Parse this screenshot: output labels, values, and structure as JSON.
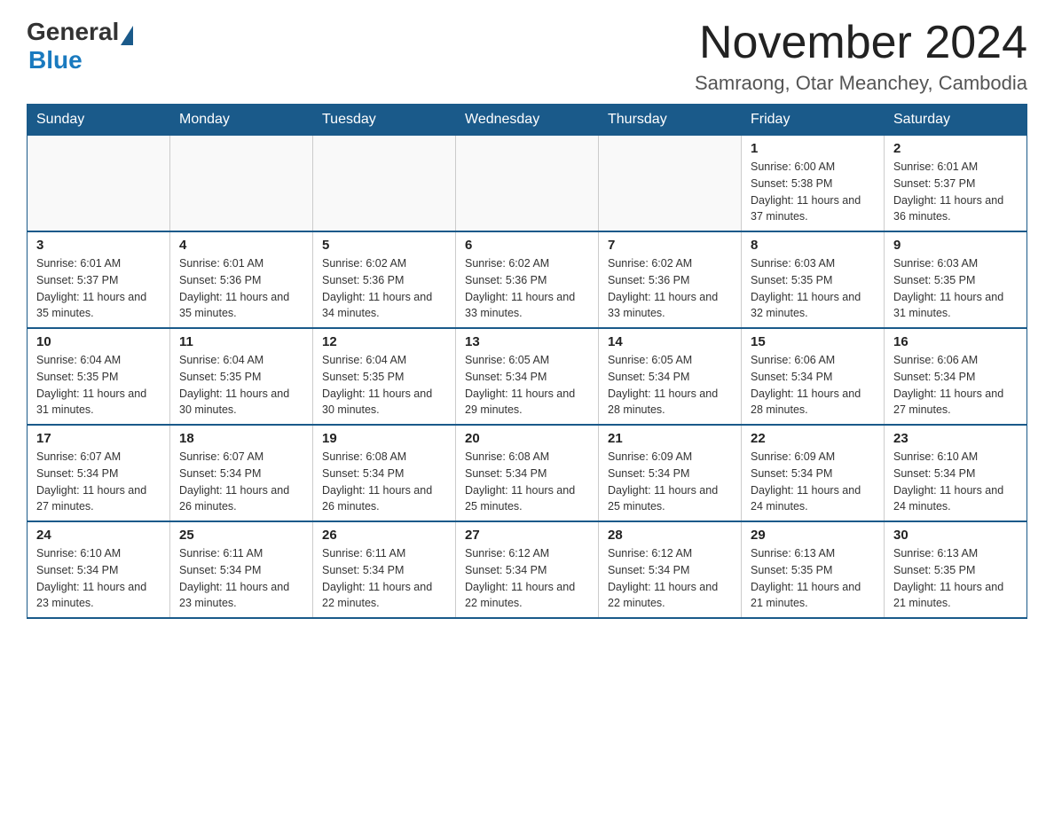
{
  "logo": {
    "general": "General",
    "blue": "Blue"
  },
  "title": "November 2024",
  "subtitle": "Samraong, Otar Meanchey, Cambodia",
  "headers": [
    "Sunday",
    "Monday",
    "Tuesday",
    "Wednesday",
    "Thursday",
    "Friday",
    "Saturday"
  ],
  "weeks": [
    [
      {
        "day": "",
        "info": ""
      },
      {
        "day": "",
        "info": ""
      },
      {
        "day": "",
        "info": ""
      },
      {
        "day": "",
        "info": ""
      },
      {
        "day": "",
        "info": ""
      },
      {
        "day": "1",
        "info": "Sunrise: 6:00 AM\nSunset: 5:38 PM\nDaylight: 11 hours and 37 minutes."
      },
      {
        "day": "2",
        "info": "Sunrise: 6:01 AM\nSunset: 5:37 PM\nDaylight: 11 hours and 36 minutes."
      }
    ],
    [
      {
        "day": "3",
        "info": "Sunrise: 6:01 AM\nSunset: 5:37 PM\nDaylight: 11 hours and 35 minutes."
      },
      {
        "day": "4",
        "info": "Sunrise: 6:01 AM\nSunset: 5:36 PM\nDaylight: 11 hours and 35 minutes."
      },
      {
        "day": "5",
        "info": "Sunrise: 6:02 AM\nSunset: 5:36 PM\nDaylight: 11 hours and 34 minutes."
      },
      {
        "day": "6",
        "info": "Sunrise: 6:02 AM\nSunset: 5:36 PM\nDaylight: 11 hours and 33 minutes."
      },
      {
        "day": "7",
        "info": "Sunrise: 6:02 AM\nSunset: 5:36 PM\nDaylight: 11 hours and 33 minutes."
      },
      {
        "day": "8",
        "info": "Sunrise: 6:03 AM\nSunset: 5:35 PM\nDaylight: 11 hours and 32 minutes."
      },
      {
        "day": "9",
        "info": "Sunrise: 6:03 AM\nSunset: 5:35 PM\nDaylight: 11 hours and 31 minutes."
      }
    ],
    [
      {
        "day": "10",
        "info": "Sunrise: 6:04 AM\nSunset: 5:35 PM\nDaylight: 11 hours and 31 minutes."
      },
      {
        "day": "11",
        "info": "Sunrise: 6:04 AM\nSunset: 5:35 PM\nDaylight: 11 hours and 30 minutes."
      },
      {
        "day": "12",
        "info": "Sunrise: 6:04 AM\nSunset: 5:35 PM\nDaylight: 11 hours and 30 minutes."
      },
      {
        "day": "13",
        "info": "Sunrise: 6:05 AM\nSunset: 5:34 PM\nDaylight: 11 hours and 29 minutes."
      },
      {
        "day": "14",
        "info": "Sunrise: 6:05 AM\nSunset: 5:34 PM\nDaylight: 11 hours and 28 minutes."
      },
      {
        "day": "15",
        "info": "Sunrise: 6:06 AM\nSunset: 5:34 PM\nDaylight: 11 hours and 28 minutes."
      },
      {
        "day": "16",
        "info": "Sunrise: 6:06 AM\nSunset: 5:34 PM\nDaylight: 11 hours and 27 minutes."
      }
    ],
    [
      {
        "day": "17",
        "info": "Sunrise: 6:07 AM\nSunset: 5:34 PM\nDaylight: 11 hours and 27 minutes."
      },
      {
        "day": "18",
        "info": "Sunrise: 6:07 AM\nSunset: 5:34 PM\nDaylight: 11 hours and 26 minutes."
      },
      {
        "day": "19",
        "info": "Sunrise: 6:08 AM\nSunset: 5:34 PM\nDaylight: 11 hours and 26 minutes."
      },
      {
        "day": "20",
        "info": "Sunrise: 6:08 AM\nSunset: 5:34 PM\nDaylight: 11 hours and 25 minutes."
      },
      {
        "day": "21",
        "info": "Sunrise: 6:09 AM\nSunset: 5:34 PM\nDaylight: 11 hours and 25 minutes."
      },
      {
        "day": "22",
        "info": "Sunrise: 6:09 AM\nSunset: 5:34 PM\nDaylight: 11 hours and 24 minutes."
      },
      {
        "day": "23",
        "info": "Sunrise: 6:10 AM\nSunset: 5:34 PM\nDaylight: 11 hours and 24 minutes."
      }
    ],
    [
      {
        "day": "24",
        "info": "Sunrise: 6:10 AM\nSunset: 5:34 PM\nDaylight: 11 hours and 23 minutes."
      },
      {
        "day": "25",
        "info": "Sunrise: 6:11 AM\nSunset: 5:34 PM\nDaylight: 11 hours and 23 minutes."
      },
      {
        "day": "26",
        "info": "Sunrise: 6:11 AM\nSunset: 5:34 PM\nDaylight: 11 hours and 22 minutes."
      },
      {
        "day": "27",
        "info": "Sunrise: 6:12 AM\nSunset: 5:34 PM\nDaylight: 11 hours and 22 minutes."
      },
      {
        "day": "28",
        "info": "Sunrise: 6:12 AM\nSunset: 5:34 PM\nDaylight: 11 hours and 22 minutes."
      },
      {
        "day": "29",
        "info": "Sunrise: 6:13 AM\nSunset: 5:35 PM\nDaylight: 11 hours and 21 minutes."
      },
      {
        "day": "30",
        "info": "Sunrise: 6:13 AM\nSunset: 5:35 PM\nDaylight: 11 hours and 21 minutes."
      }
    ]
  ]
}
